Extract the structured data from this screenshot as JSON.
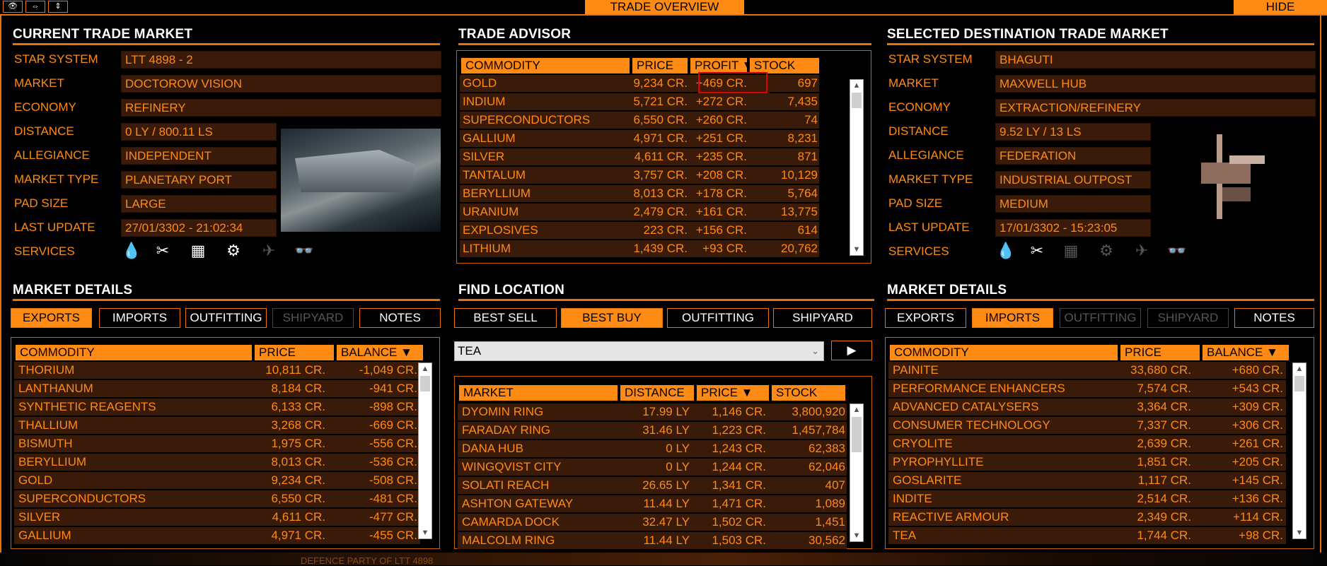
{
  "topbar": {
    "btns": [
      "👁",
      "⇔",
      "⇕"
    ],
    "center_tab": "TRADE OVERVIEW",
    "hide_label": "HIDE"
  },
  "current": {
    "title": "CURRENT TRADE MARKET",
    "fields": [
      {
        "label": "STAR SYSTEM",
        "value": "LTT 4898 - 2"
      },
      {
        "label": "MARKET",
        "value": "DOCTOROW VISION"
      },
      {
        "label": "ECONOMY",
        "value": "REFINERY"
      },
      {
        "label": "DISTANCE",
        "value": "0 LY / 800.11 LS"
      },
      {
        "label": "ALLEGIANCE",
        "value": "INDEPENDENT"
      },
      {
        "label": "MARKET TYPE",
        "value": "PLANETARY PORT"
      },
      {
        "label": "PAD SIZE",
        "value": "LARGE"
      },
      {
        "label": "LAST UPDATE",
        "value": "27/01/3302 - 21:02:34"
      }
    ],
    "services_label": "SERVICES"
  },
  "advisor": {
    "title": "TRADE ADVISOR",
    "headers": [
      "COMMODITY",
      "PRICE",
      "PROFIT ▼",
      "STOCK"
    ],
    "rows": [
      [
        "GOLD",
        "9,234 CR.",
        "+469 CR.",
        "697"
      ],
      [
        "INDIUM",
        "5,721 CR.",
        "+272 CR.",
        "7,435"
      ],
      [
        "SUPERCONDUCTORS",
        "6,550 CR.",
        "+260 CR.",
        "74"
      ],
      [
        "GALLIUM",
        "4,971 CR.",
        "+251 CR.",
        "8,231"
      ],
      [
        "SILVER",
        "4,611 CR.",
        "+235 CR.",
        "871"
      ],
      [
        "TANTALUM",
        "3,757 CR.",
        "+208 CR.",
        "10,129"
      ],
      [
        "BERYLLIUM",
        "8,013 CR.",
        "+178 CR.",
        "5,764"
      ],
      [
        "URANIUM",
        "2,479 CR.",
        "+161 CR.",
        "13,775"
      ],
      [
        "EXPLOSIVES",
        "223 CR.",
        "+156 CR.",
        "614"
      ],
      [
        "LITHIUM",
        "1,439 CR.",
        "+93 CR.",
        "20,762"
      ]
    ]
  },
  "selected": {
    "title": "SELECTED DESTINATION TRADE MARKET",
    "fields": [
      {
        "label": "STAR SYSTEM",
        "value": "BHAGUTI"
      },
      {
        "label": "MARKET",
        "value": "MAXWELL HUB"
      },
      {
        "label": "ECONOMY",
        "value": "EXTRACTION/REFINERY"
      },
      {
        "label": "DISTANCE",
        "value": "9.52 LY / 13 LS"
      },
      {
        "label": "ALLEGIANCE",
        "value": "FEDERATION"
      },
      {
        "label": "MARKET TYPE",
        "value": "INDUSTRIAL OUTPOST"
      },
      {
        "label": "PAD SIZE",
        "value": "MEDIUM"
      },
      {
        "label": "LAST UPDATE",
        "value": "17/01/3302 - 15:23:05"
      }
    ],
    "services_label": "SERVICES"
  },
  "details_left": {
    "title": "MARKET DETAILS",
    "tabs": [
      "EXPORTS",
      "IMPORTS",
      "OUTFITTING",
      "SHIPYARD",
      "NOTES"
    ],
    "headers": [
      "COMMODITY",
      "PRICE",
      "BALANCE ▼"
    ],
    "rows": [
      [
        "THORIUM",
        "10,811 CR.",
        "-1,049 CR."
      ],
      [
        "LANTHANUM",
        "8,184 CR.",
        "-941 CR."
      ],
      [
        "SYNTHETIC REAGENTS",
        "6,133 CR.",
        "-898 CR."
      ],
      [
        "THALLIUM",
        "3,268 CR.",
        "-669 CR."
      ],
      [
        "BISMUTH",
        "1,975 CR.",
        "-556 CR."
      ],
      [
        "BERYLLIUM",
        "8,013 CR.",
        "-536 CR."
      ],
      [
        "GOLD",
        "9,234 CR.",
        "-508 CR."
      ],
      [
        "SUPERCONDUCTORS",
        "6,550 CR.",
        "-481 CR."
      ],
      [
        "SILVER",
        "4,611 CR.",
        "-477 CR."
      ],
      [
        "GALLIUM",
        "4,971 CR.",
        "-455 CR."
      ]
    ]
  },
  "find": {
    "title": "FIND LOCATION",
    "tabs": [
      "BEST SELL",
      "BEST BUY",
      "OUTFITTING",
      "SHIPYARD"
    ],
    "dropdown_value": "TEA",
    "go_label": "▶",
    "headers": [
      "MARKET",
      "DISTANCE",
      "PRICE ▼",
      "STOCK"
    ],
    "rows": [
      [
        "DYOMIN RING",
        "17.99 LY",
        "1,146 CR.",
        "3,800,920"
      ],
      [
        "FARADAY RING",
        "31.46 LY",
        "1,223 CR.",
        "1,457,784"
      ],
      [
        "DANA HUB",
        "0 LY",
        "1,243 CR.",
        "62,383"
      ],
      [
        "WINGQVIST CITY",
        "0 LY",
        "1,244 CR.",
        "62,046"
      ],
      [
        "SOLATI REACH",
        "26.65 LY",
        "1,341 CR.",
        "407"
      ],
      [
        "ASHTON GATEWAY",
        "11.44 LY",
        "1,471 CR.",
        "1,089"
      ],
      [
        "CAMARDA DOCK",
        "32.47 LY",
        "1,502 CR.",
        "1,451"
      ],
      [
        "MALCOLM RING",
        "11.44 LY",
        "1,503 CR.",
        "30,562"
      ]
    ]
  },
  "details_right": {
    "title": "MARKET DETAILS",
    "tabs": [
      "EXPORTS",
      "IMPORTS",
      "OUTFITTING",
      "SHIPYARD",
      "NOTES"
    ],
    "headers": [
      "COMMODITY",
      "PRICE",
      "BALANCE ▼"
    ],
    "rows": [
      [
        "PAINITE",
        "33,680 CR.",
        "+680 CR."
      ],
      [
        "PERFORMANCE ENHANCERS",
        "7,574 CR.",
        "+543 CR."
      ],
      [
        "ADVANCED CATALYSERS",
        "3,364 CR.",
        "+309 CR."
      ],
      [
        "CONSUMER TECHNOLOGY",
        "7,337 CR.",
        "+306 CR."
      ],
      [
        "CRYOLITE",
        "2,639 CR.",
        "+261 CR."
      ],
      [
        "PYROPHYLLITE",
        "1,851 CR.",
        "+205 CR."
      ],
      [
        "GOSLARITE",
        "1,117 CR.",
        "+145 CR."
      ],
      [
        "INDITE",
        "2,514 CR.",
        "+136 CR."
      ],
      [
        "REACTIVE ARMOUR",
        "2,349 CR.",
        "+114 CR."
      ],
      [
        "TEA",
        "1,744 CR.",
        "+98 CR."
      ]
    ]
  },
  "bottom_text": "DEFENCE PARTY OF LTT 4898"
}
